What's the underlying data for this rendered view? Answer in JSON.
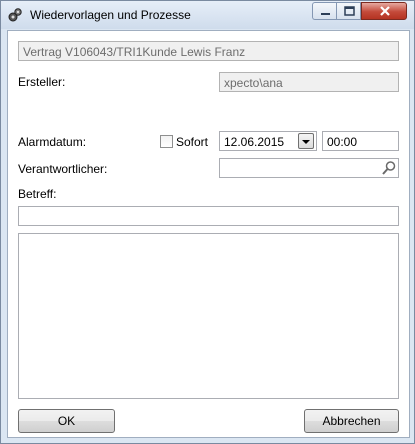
{
  "window": {
    "title": "Wiedervorlagen und Prozesse"
  },
  "header": {
    "contract_value": "Vertrag V106043/TRI1Kunde Lewis Franz"
  },
  "creator": {
    "label": "Ersteller:",
    "value": "xpecto\\ana"
  },
  "alarm": {
    "label": "Alarmdatum:",
    "sofort_label": "Sofort",
    "sofort_checked": false,
    "date_value": "12.06.2015",
    "time_value": "00:00"
  },
  "responsible": {
    "label": "Verantwortlicher:",
    "value": ""
  },
  "subject": {
    "label": "Betreff:",
    "value": ""
  },
  "notes": {
    "value": ""
  },
  "buttons": {
    "ok_label": "OK",
    "cancel_label": "Abbrechen"
  },
  "icons": {
    "app": "gears-icon",
    "minimize": "minimize-icon",
    "maximize": "maximize-icon",
    "close": "close-icon",
    "search": "search-icon",
    "dropdown": "chevron-down-icon"
  }
}
